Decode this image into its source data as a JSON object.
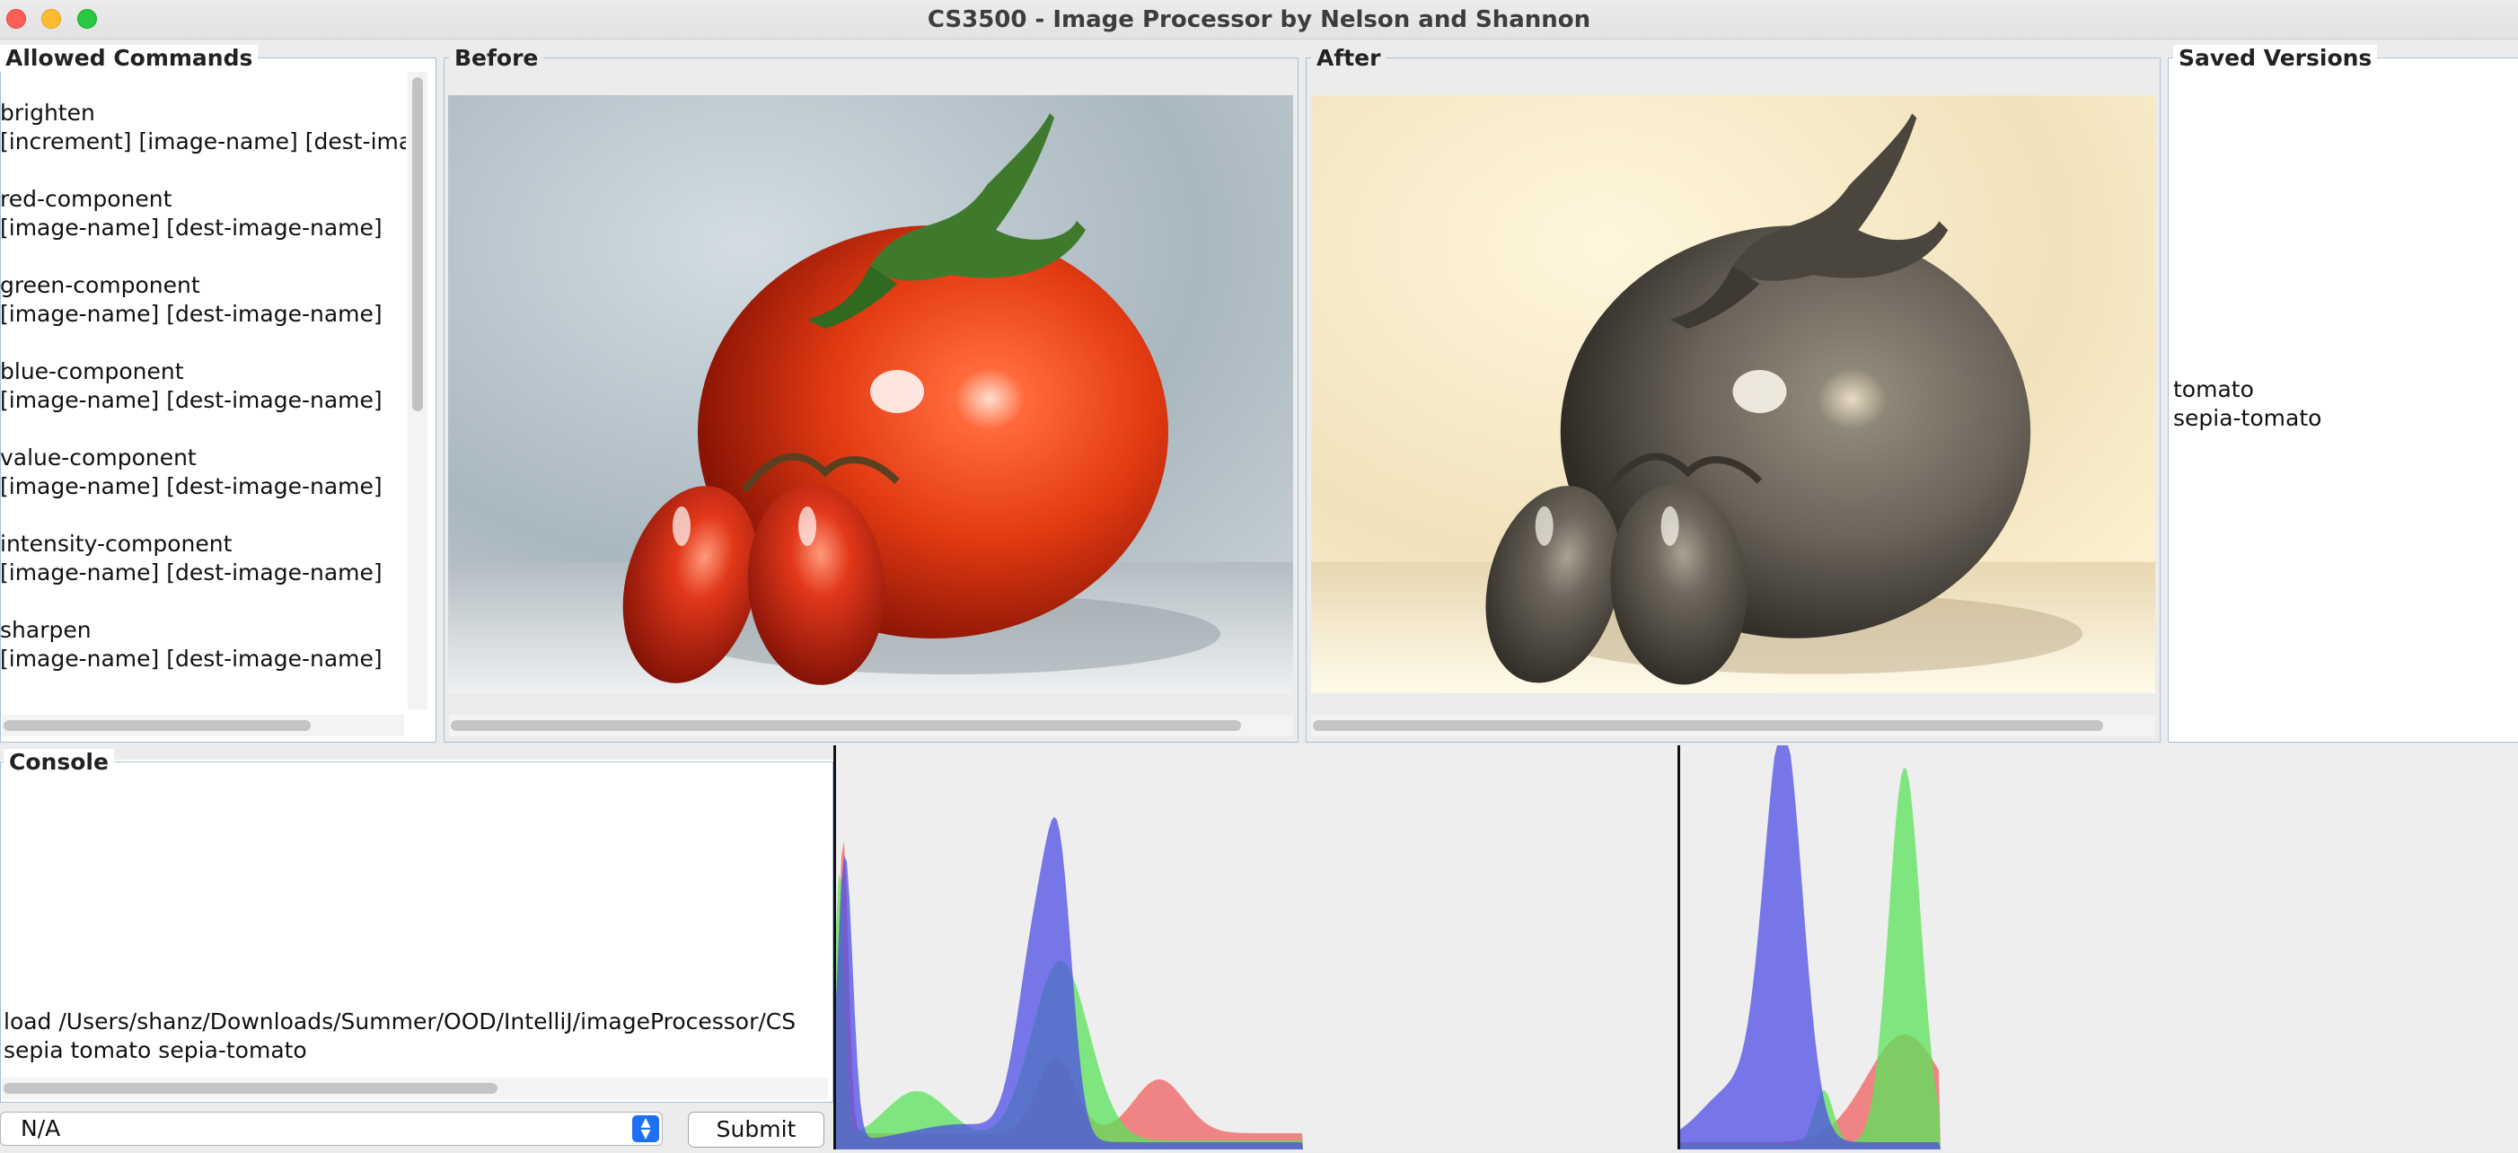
{
  "window": {
    "title": "CS3500 - Image Processor by Nelson and Shannon"
  },
  "commands_panel": {
    "legend": "Allowed Commands",
    "commands": [
      {
        "name": "brighten",
        "args": "[increment] [image-name] [dest-ima"
      },
      {
        "name": "red-component",
        "args": "[image-name] [dest-image-name]"
      },
      {
        "name": "green-component",
        "args": "[image-name] [dest-image-name]"
      },
      {
        "name": "blue-component",
        "args": "[image-name] [dest-image-name]"
      },
      {
        "name": "value-component",
        "args": "[image-name] [dest-image-name]"
      },
      {
        "name": "intensity-component",
        "args": "[image-name] [dest-image-name]"
      },
      {
        "name": "sharpen",
        "args": "[image-name] [dest-image-name]"
      }
    ]
  },
  "before_panel": {
    "legend": "Before"
  },
  "after_panel": {
    "legend": "After"
  },
  "saved_panel": {
    "legend": "Saved Versions",
    "items": [
      "tomato",
      "sepia-tomato"
    ]
  },
  "console": {
    "legend": "Console",
    "lines": [
      "load /Users/shanz/Downloads/Summer/OOD/IntelliJ/imageProcessor/CS",
      "sepia tomato sepia-tomato"
    ]
  },
  "controls": {
    "select_value": "N/A",
    "submit_label": "Submit"
  },
  "colors": {
    "frame_border": "#a9bfd6",
    "hist_red": "#f06060",
    "hist_green": "#5ae35a",
    "hist_blue": "#4d4de6"
  }
}
